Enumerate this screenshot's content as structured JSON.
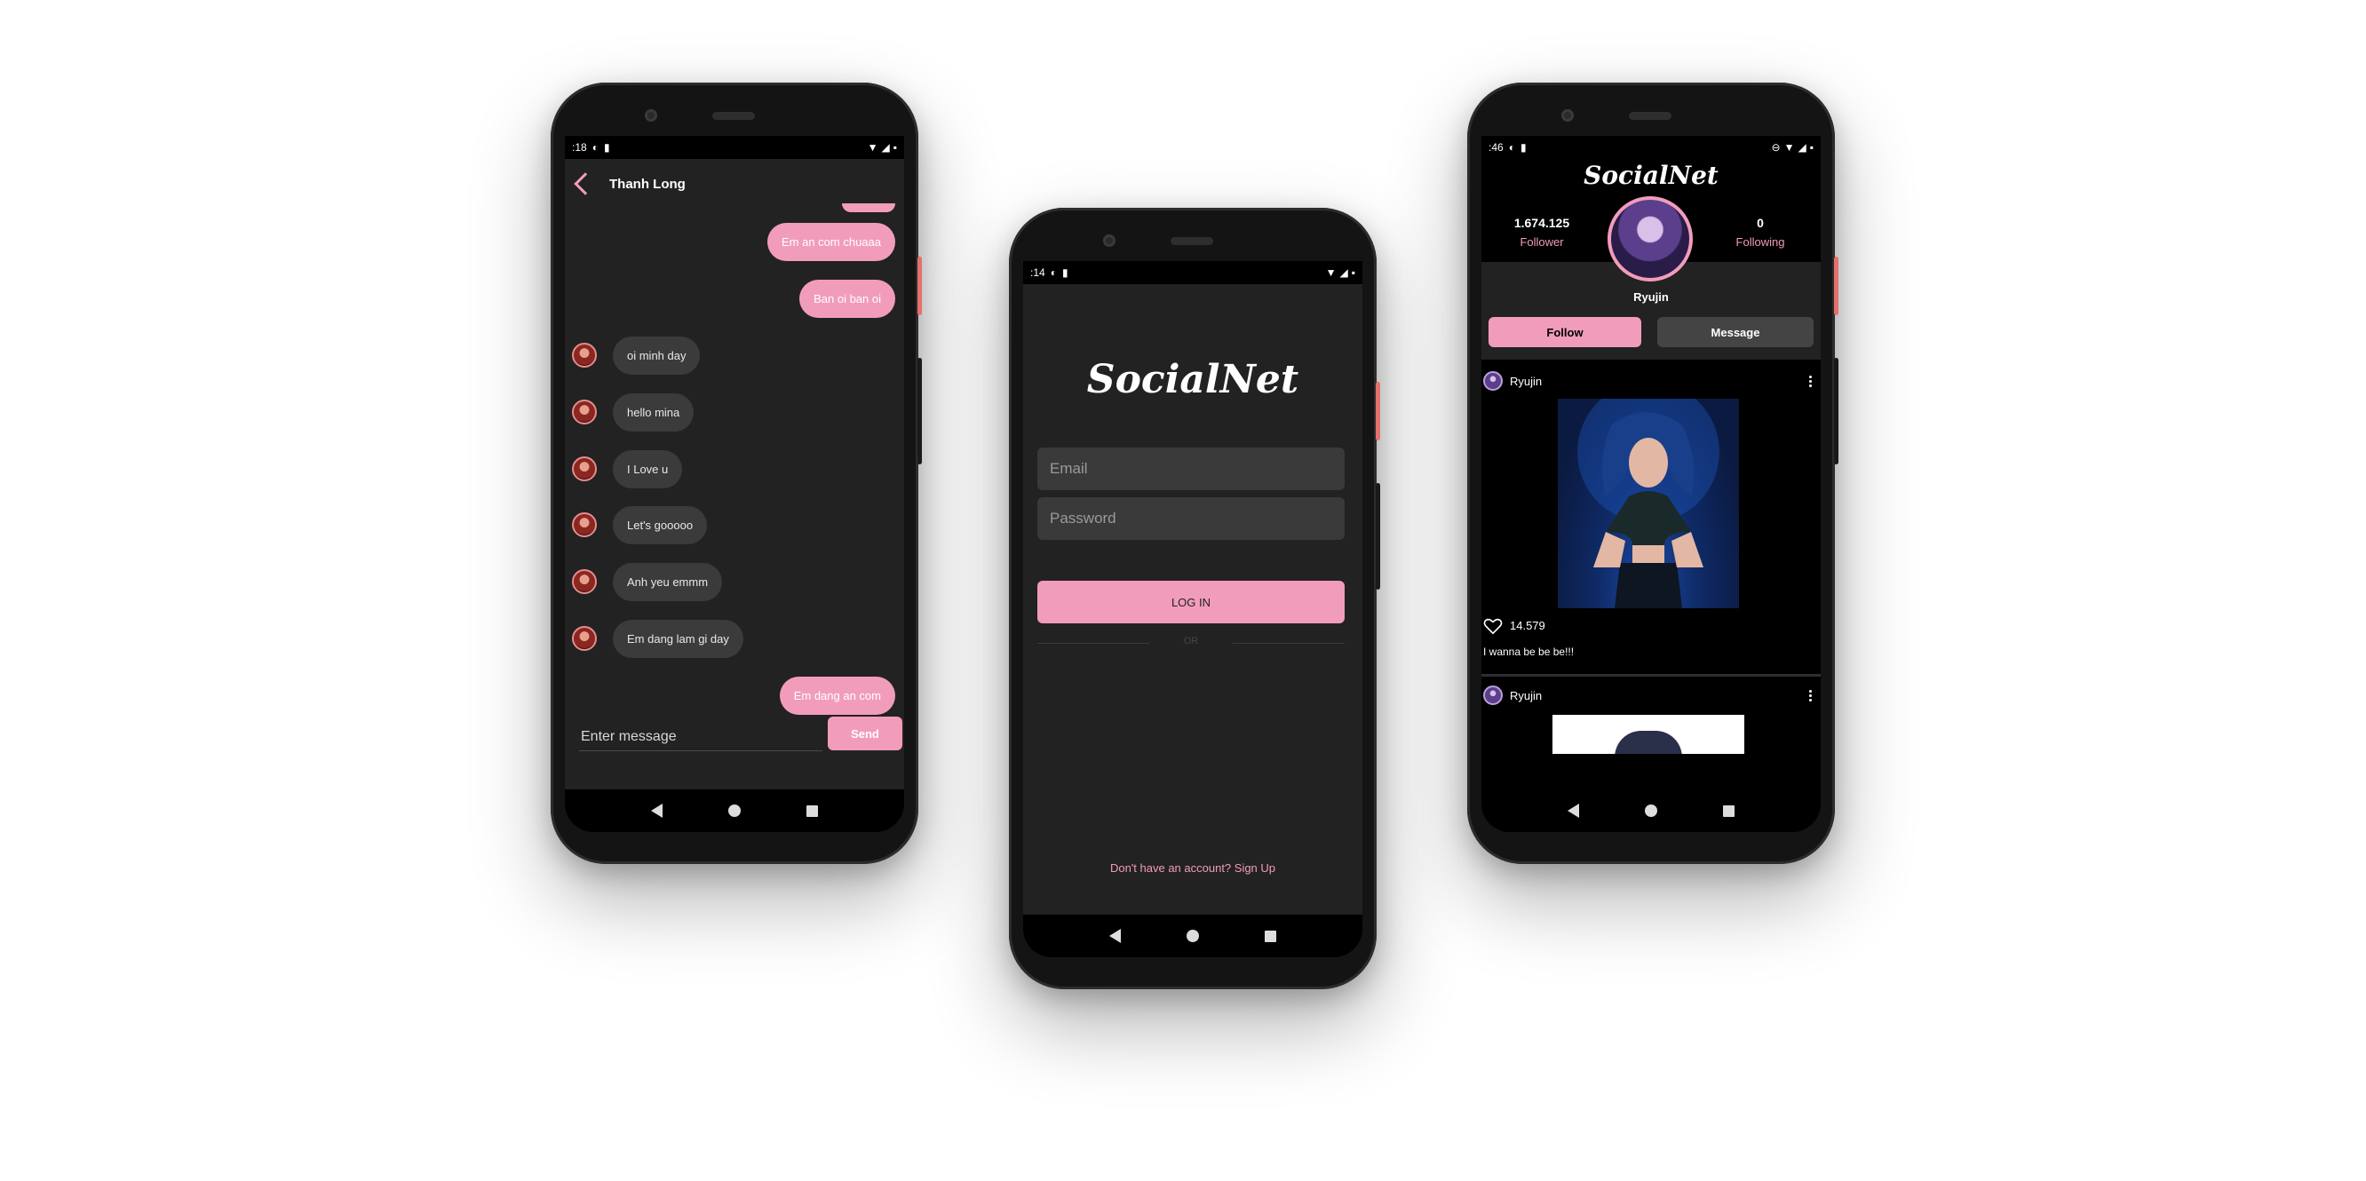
{
  "colors": {
    "accent": "#f29cbc",
    "background": "#222222",
    "bubble_in": "#3b3b3b"
  },
  "chat_phone": {
    "status_time": ":18",
    "contact_name": "Thanh Long",
    "messages": [
      {
        "from": "me",
        "text": "Em an com chuaaa"
      },
      {
        "from": "me",
        "text": "Ban oi ban oi"
      },
      {
        "from": "them",
        "text": "oi minh day"
      },
      {
        "from": "them",
        "text": "hello mina"
      },
      {
        "from": "them",
        "text": "I Love u"
      },
      {
        "from": "them",
        "text": "Let's gooooo"
      },
      {
        "from": "them",
        "text": "Anh yeu emmm"
      },
      {
        "from": "them",
        "text": "Em dang lam gi day"
      },
      {
        "from": "me",
        "text": "Em dang an com"
      }
    ],
    "input_placeholder": "Enter message",
    "send_label": "Send"
  },
  "login_phone": {
    "status_time": ":14",
    "app_name": "SocialNet",
    "email_placeholder": "Email",
    "password_placeholder": "Password",
    "login_label": "LOG IN",
    "or_label": "OR",
    "signup_text": "Don't have an account? Sign Up"
  },
  "profile_phone": {
    "status_time": ":46",
    "app_name": "SocialNet",
    "followers_count": "1.674.125",
    "followers_label": "Follower",
    "following_count": "0",
    "following_label": "Following",
    "username": "Ryujin",
    "follow_label": "Follow",
    "message_label": "Message",
    "posts": [
      {
        "user": "Ryujin",
        "likes": "14.579",
        "caption": "I wanna be be be!!!"
      },
      {
        "user": "Ryujin"
      }
    ]
  }
}
